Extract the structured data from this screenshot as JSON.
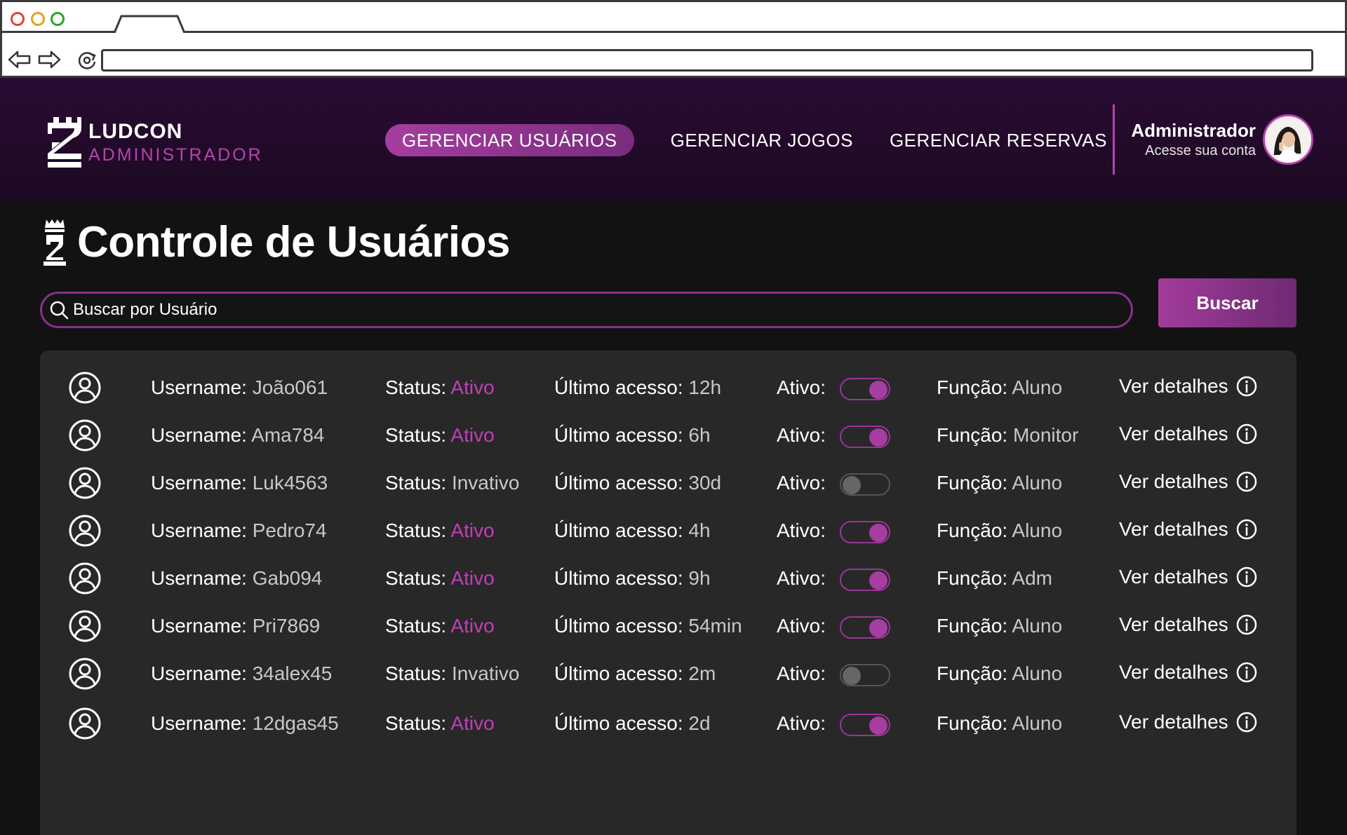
{
  "header": {
    "logo_title": "LUDCON",
    "logo_subtitle": "ADMINISTRADOR",
    "nav": [
      {
        "label": "GERENCIAR USUÁRIOS",
        "active": true
      },
      {
        "label": "GERENCIAR JOGOS",
        "active": false
      },
      {
        "label": "GERENCIAR RESERVAS",
        "active": false
      }
    ],
    "admin_name": "Administrador",
    "admin_sub": "Acesse sua conta"
  },
  "page": {
    "title": "Controle de Usuários",
    "search_placeholder": "Buscar por Usuário",
    "search_button": "Buscar"
  },
  "labels": {
    "username": "Username:",
    "status": "Status:",
    "last_access": "Último acesso:",
    "active": "Ativo:",
    "role": "Função:",
    "details": "Ver detalhes"
  },
  "users": [
    {
      "username": "João061",
      "status": "Ativo",
      "last_access": "12h",
      "active": true,
      "role": "Aluno"
    },
    {
      "username": "Ama784",
      "status": "Ativo",
      "last_access": "6h",
      "active": true,
      "role": "Monitor"
    },
    {
      "username": "Luk4563",
      "status": "Invativo",
      "last_access": "30d",
      "active": false,
      "role": "Aluno"
    },
    {
      "username": "Pedro74",
      "status": "Ativo",
      "last_access": "4h",
      "active": true,
      "role": "Aluno"
    },
    {
      "username": "Gab094",
      "status": "Ativo",
      "last_access": "9h",
      "active": true,
      "role": "Adm"
    },
    {
      "username": "Pri7869",
      "status": "Ativo",
      "last_access": "54min",
      "active": true,
      "role": "Aluno"
    },
    {
      "username": "34alex45",
      "status": "Invativo",
      "last_access": "2m",
      "active": false,
      "role": "Aluno"
    },
    {
      "username": "12dgas45",
      "status": "Ativo",
      "last_access": "2d",
      "active": true,
      "role": "Aluno"
    }
  ],
  "colors": {
    "accent": "#b545ad",
    "header_bg": "#2a0b33",
    "panel_bg": "#282828",
    "page_bg": "#121212"
  }
}
